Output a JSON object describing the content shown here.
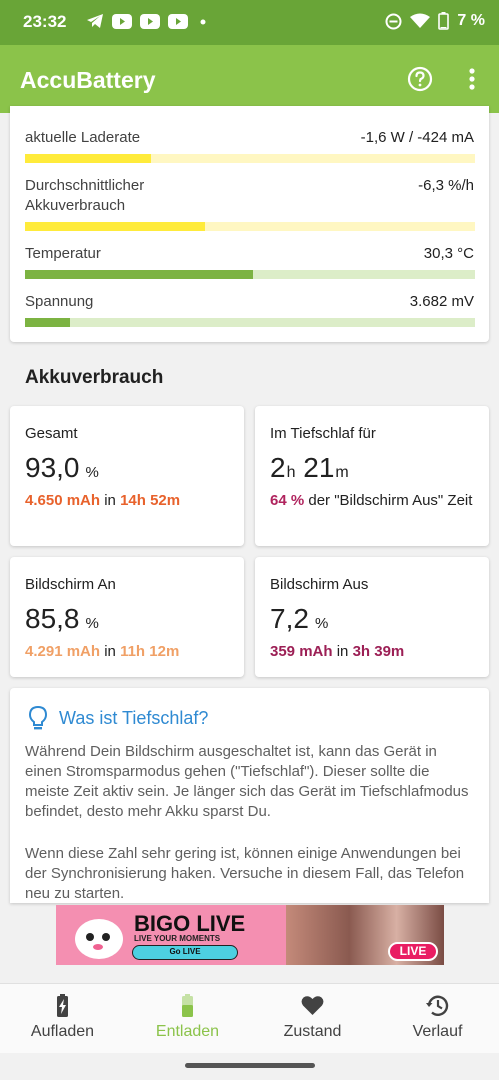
{
  "status_bar": {
    "time": "23:32",
    "battery_percent": "7 %",
    "icons_left": [
      "telegram-icon",
      "youtube-icon",
      "youtube-icon",
      "youtube-icon",
      "dot-icon"
    ],
    "icons_right": [
      "dnd-icon",
      "wifi-icon",
      "battery-icon"
    ]
  },
  "app_bar": {
    "title": "AccuBattery",
    "help_icon": "help-circle-icon",
    "more_icon": "more-vert-icon"
  },
  "metrics": [
    {
      "label": "aktuelle Laderate",
      "value": "-1,6 W / -424 mA",
      "fill": 0.28,
      "color": "#ffeb3b",
      "track": "#fff7c2"
    },
    {
      "label": "Durchschnittlicher Akkuverbrauch",
      "value": "-6,3 %/h",
      "fill": 0.4,
      "color": "#ffeb3b",
      "track": "#fff7c2"
    },
    {
      "label": "Temperatur",
      "value": "30,3 °C",
      "fill": 0.507,
      "color": "#7cb342",
      "track": "#dcedc8"
    },
    {
      "label": "Spannung",
      "value": "3.682 mV",
      "fill": 0.1,
      "color": "#7cb342",
      "track": "#dcedc8"
    }
  ],
  "section_title": "Akkuverbrauch",
  "stats": {
    "gesamt": {
      "label": "Gesamt",
      "value": "93,0",
      "unit": "%",
      "mah": "4.650 mAh",
      "in": "in",
      "time": "14h 52m",
      "color": "#e8622c"
    },
    "tiefschlaf": {
      "label": "Im Tiefschlaf für",
      "h": "2",
      "h_unit": "h",
      "m": "21",
      "m_unit": "m",
      "percent": "64 %",
      "text": "der \"Bildschirm Aus\" Zeit",
      "color": "#b0245e"
    },
    "an": {
      "label": "Bildschirm An",
      "value": "85,8",
      "unit": "%",
      "mah": "4.291 mAh",
      "in": "in",
      "time": "11h 12m",
      "color": "#f0a066"
    },
    "aus": {
      "label": "Bildschirm Aus",
      "value": "7,2",
      "unit": "%",
      "mah": "359 mAh",
      "in": "in",
      "time": "3h 39m",
      "color": "#9c1f55"
    }
  },
  "tip": {
    "title": "Was ist Tiefschlaf?",
    "icon": "lightbulb-icon",
    "p1": "Während Dein Bildschirm ausgeschaltet ist, kann das Gerät in einen Stromsparmodus gehen (\"Tiefschlaf\"). Dieser sollte die meiste Zeit aktiv sein. Je länger sich das Gerät im Tiefschlafmodus befindet, desto mehr Akku sparst Du.",
    "p2": "Wenn diese Zahl sehr gering ist, können einige Anwendungen bei der Synchronisierung haken. Versuche in diesem Fall, das Telefon neu zu starten."
  },
  "ad": {
    "brand": "BIGO LIVE",
    "tagline": "LIVE YOUR MOMENTS",
    "cta": "Go LIVE",
    "badge": "LIVE"
  },
  "bottom_nav": [
    {
      "label": "Aufladen",
      "icon": "battery-charging-icon",
      "active": false
    },
    {
      "label": "Entladen",
      "icon": "battery-icon",
      "active": true
    },
    {
      "label": "Zustand",
      "icon": "heart-icon",
      "active": false
    },
    {
      "label": "Verlauf",
      "icon": "history-icon",
      "active": false
    }
  ]
}
